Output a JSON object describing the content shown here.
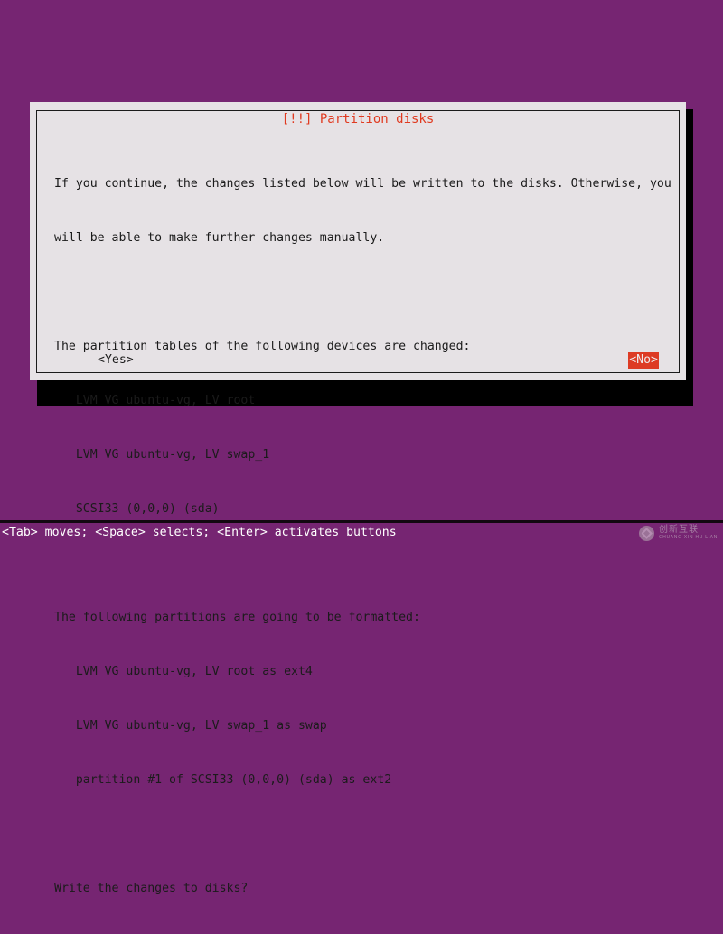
{
  "screen": {
    "background_color": "#762572",
    "text_color": "#1b1b1b"
  },
  "dialog": {
    "title": "[!!] Partition disks",
    "title_color": "#e03a20",
    "background_color": "#e6e2e5",
    "paragraphs": {
      "intro_line1": "If you continue, the changes listed below will be written to the disks. Otherwise, you",
      "intro_line2": "will be able to make further changes manually.",
      "changed_heading": "The partition tables of the following devices are changed:",
      "changed_devices": [
        "   LVM VG ubuntu-vg, LV root",
        "   LVM VG ubuntu-vg, LV swap_1",
        "   SCSI33 (0,0,0) (sda)"
      ],
      "formatted_heading": "The following partitions are going to be formatted:",
      "formatted_partitions": [
        "   LVM VG ubuntu-vg, LV root as ext4",
        "   LVM VG ubuntu-vg, LV swap_1 as swap",
        "   partition #1 of SCSI33 (0,0,0) (sda) as ext2"
      ],
      "question": "Write the changes to disks?"
    },
    "buttons": {
      "yes": "<Yes>",
      "no": "<No>",
      "selected": "<No>",
      "selected_background": "#dd3b24",
      "selected_foreground": "#efe9ea"
    }
  },
  "statusbar": {
    "help_text": "<Tab> moves; <Space> selects; <Enter> activates buttons",
    "background_color": "#762572",
    "text_color": "#ffffff"
  },
  "watermark": {
    "chinese": "创新互联",
    "latin": "CHUANG XIN HU LIAN"
  }
}
